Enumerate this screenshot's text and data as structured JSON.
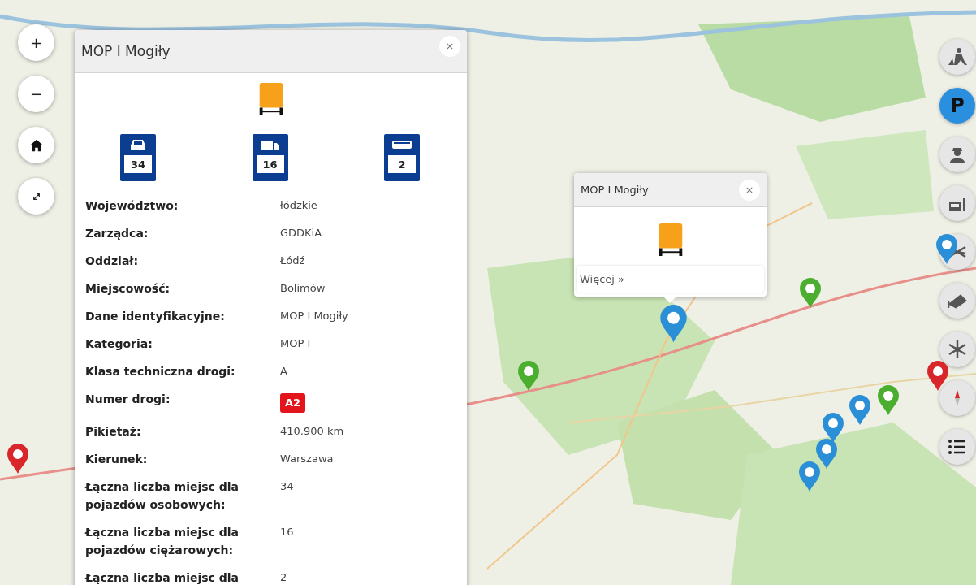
{
  "map_controls": [
    {
      "kind": "zoom-in",
      "label": "+"
    },
    {
      "kind": "zoom-out",
      "label": "−"
    },
    {
      "kind": "home"
    },
    {
      "kind": "fullscreen"
    }
  ],
  "layers": [
    {
      "kind": "roadworks",
      "selected": false
    },
    {
      "kind": "parking",
      "label": "P",
      "selected": true
    },
    {
      "kind": "officer",
      "selected": false
    },
    {
      "kind": "garage",
      "selected": false
    },
    {
      "kind": "crossed",
      "selected": false
    },
    {
      "kind": "camera",
      "selected": false
    },
    {
      "kind": "snow",
      "selected": false
    },
    {
      "kind": "compass",
      "selected": false
    },
    {
      "kind": "list",
      "selected": false
    }
  ],
  "markers": [
    {
      "color": "#2a8fd6"
    },
    {
      "color": "#4cae2f"
    },
    {
      "color": "#4cae2f"
    },
    {
      "color": "#4cae2f"
    },
    {
      "color": "#2a8fd6"
    },
    {
      "color": "#2a8fd6"
    },
    {
      "color": "#2a8fd6"
    },
    {
      "color": "#2a8fd6"
    },
    {
      "color": "#d9262b"
    },
    {
      "color": "#d9262b"
    },
    {
      "color": "#2a8fd6"
    }
  ],
  "details_panel": {
    "title": "MOP I Mogiły",
    "signs": [
      {
        "kind": "car",
        "count": "34"
      },
      {
        "kind": "truck",
        "count": "16"
      },
      {
        "kind": "bus",
        "count": "2"
      }
    ],
    "rows": [
      {
        "label": "Województwo:",
        "value": "łódzkie"
      },
      {
        "label": "Zarządca:",
        "value": "GDDKiA"
      },
      {
        "label": "Oddział:",
        "value": "Łódź"
      },
      {
        "label": "Miejscowość:",
        "value": "Bolimów"
      },
      {
        "label": "Dane identyfikacyjne:",
        "value": "MOP I Mogiły"
      },
      {
        "label": "Kategoria:",
        "value": "MOP I"
      },
      {
        "label": "Klasa techniczna drogi:",
        "value": "A"
      },
      {
        "label": "Numer drogi:",
        "value": "A2",
        "kind": "road-badge"
      },
      {
        "label": "Pikietaż:",
        "value": "410.900 km"
      },
      {
        "label": "Kierunek:",
        "value": "Warszawa"
      },
      {
        "label": "Łączna liczba miejsc dla pojazdów osobowych:",
        "value": "34"
      },
      {
        "label": "Łączna liczba miejsc dla pojazdów ciężarowych:",
        "value": "16"
      },
      {
        "label": "Łączna liczba miejsc dla",
        "value": "2"
      }
    ]
  },
  "popup": {
    "title": "MOP I Mogiły",
    "link": "Więcej »"
  }
}
